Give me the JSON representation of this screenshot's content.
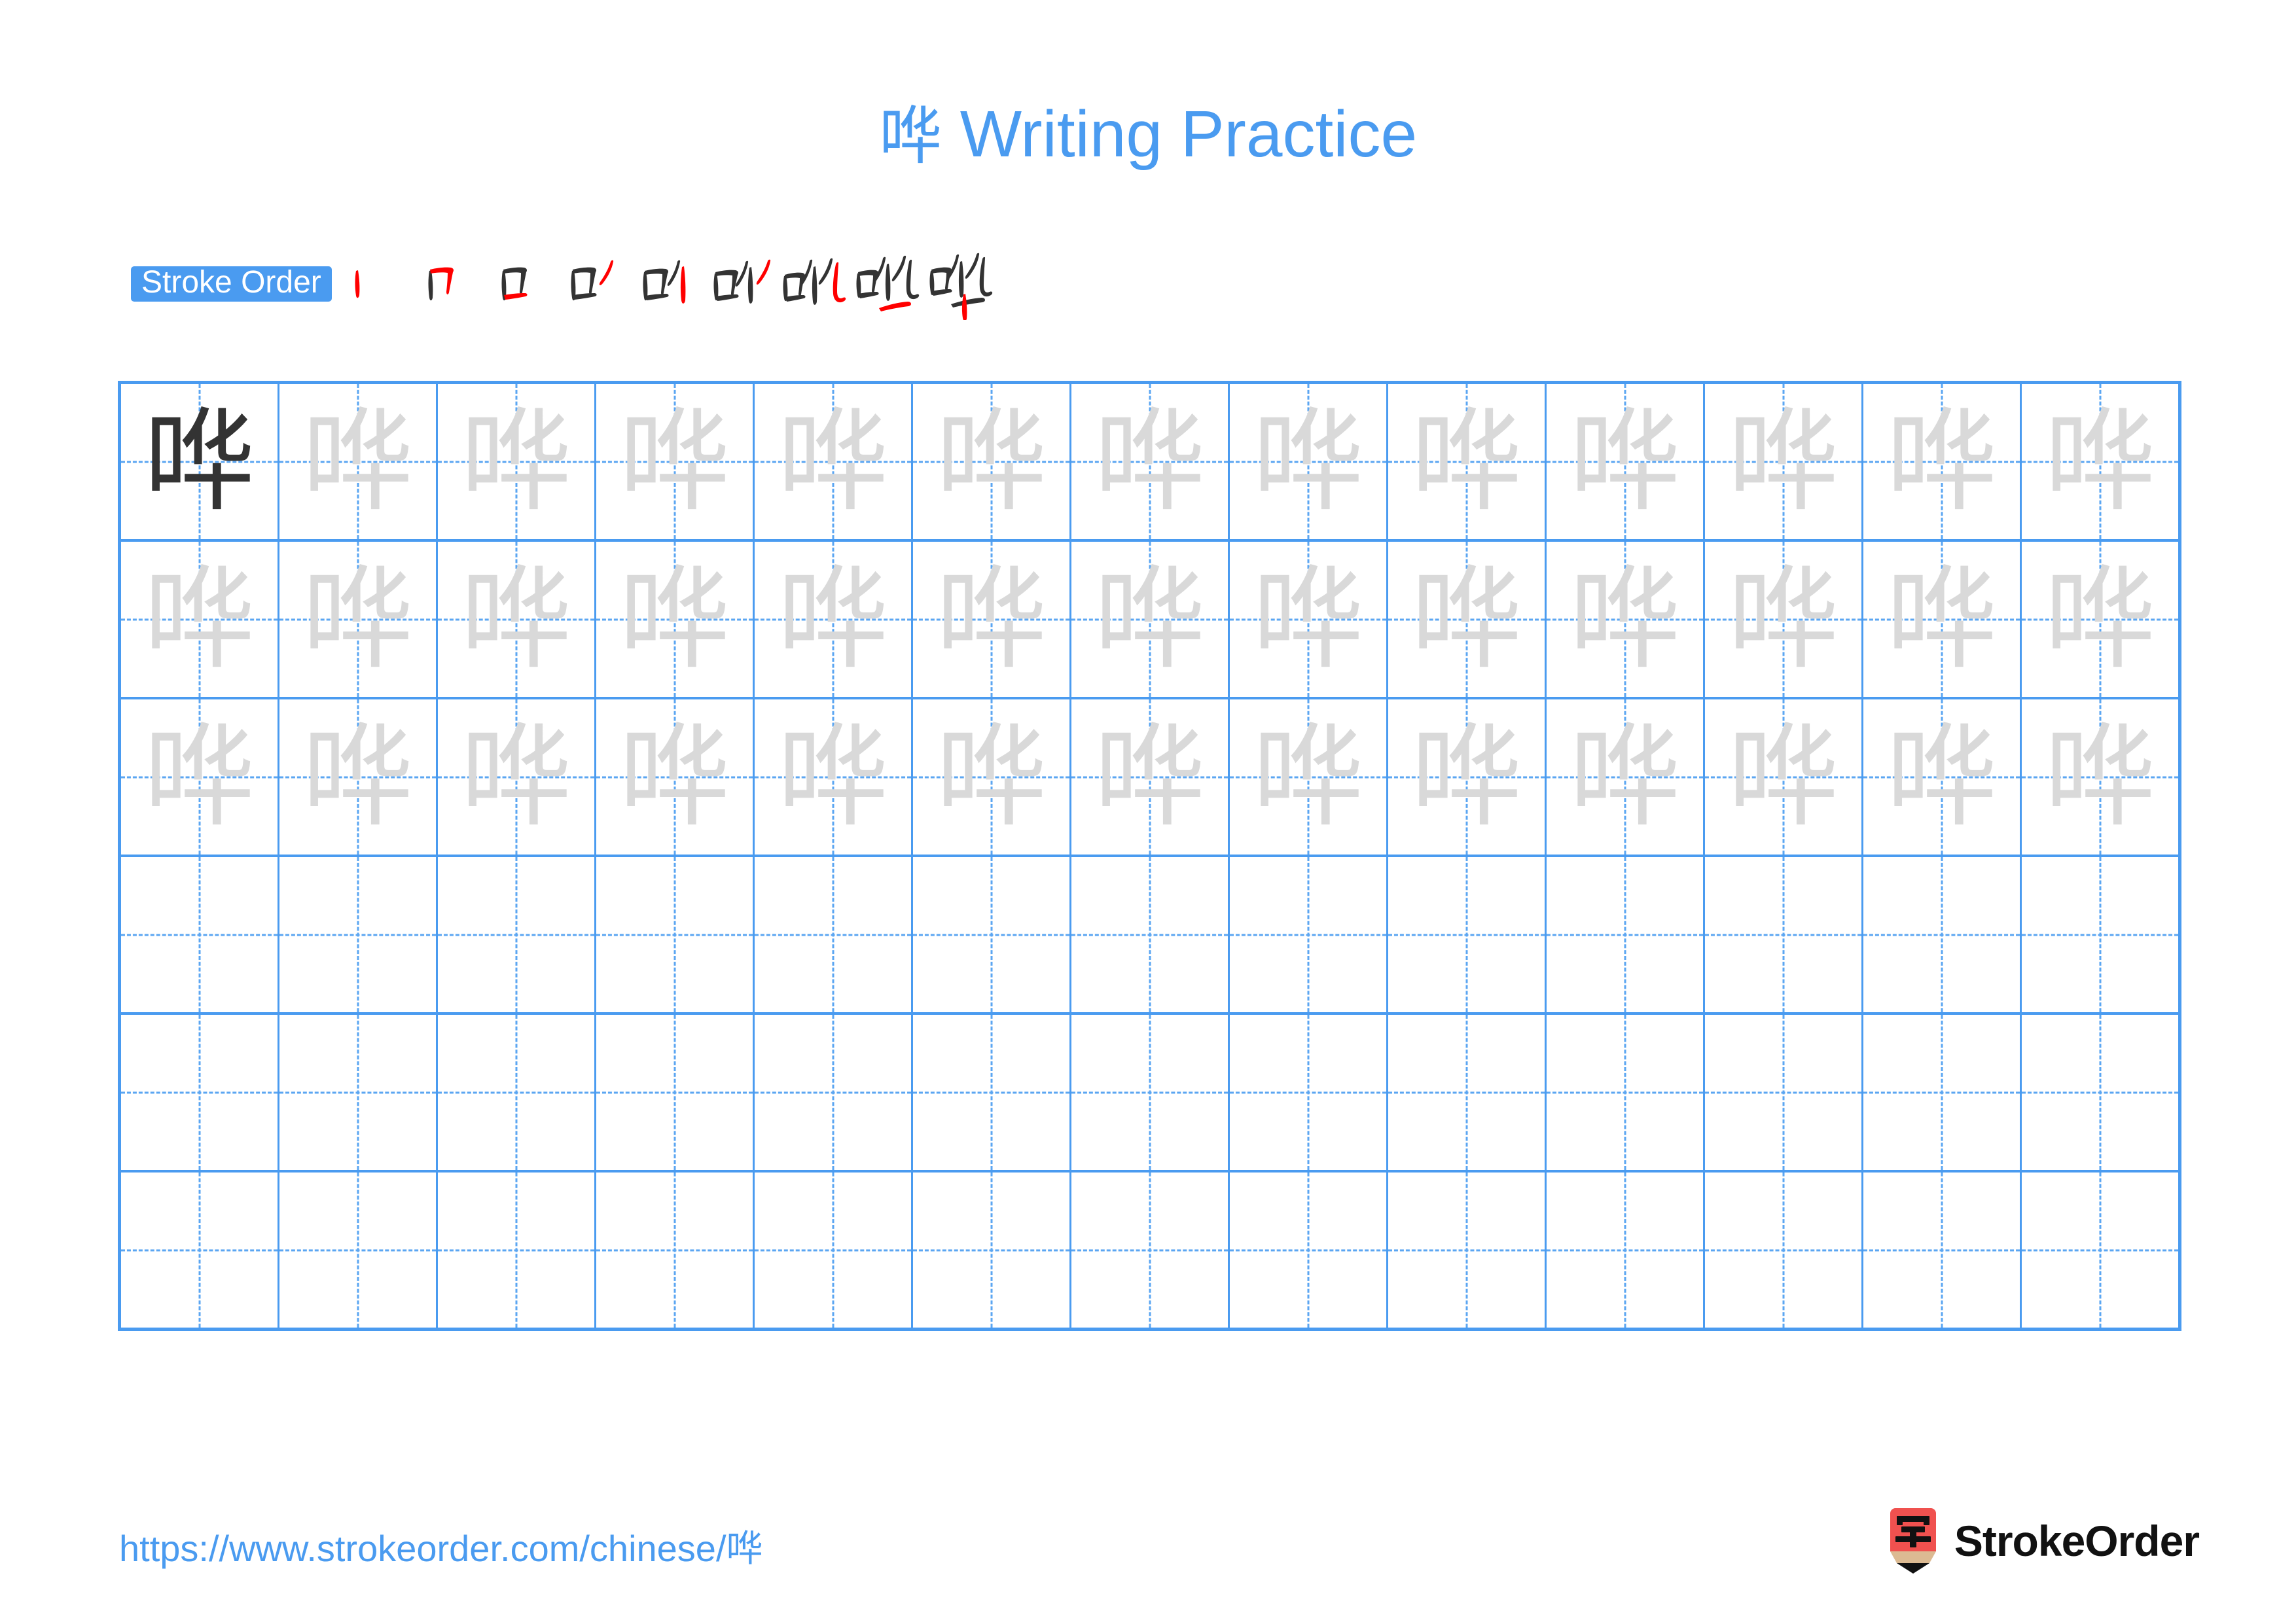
{
  "page": {
    "character": "哗",
    "title_suffix": " Writing Practice",
    "title_full": "哗 Writing Practice",
    "background_color": "#ffffff",
    "accent_color": "#4a9bf0",
    "stroke_highlight_color": "#ff0000",
    "stroke_existing_color": "#333333",
    "ghost_char_color": "#d9d9d9",
    "dark_char_color": "#333333"
  },
  "stroke_order": {
    "badge_label": "Stroke Order",
    "total_strokes": 9,
    "steps": [
      {
        "index": 1,
        "name": "stroke-step-1",
        "cumulative": "丨"
      },
      {
        "index": 2,
        "name": "stroke-step-2",
        "cumulative": "冂"
      },
      {
        "index": 3,
        "name": "stroke-step-3",
        "cumulative": "口"
      },
      {
        "index": 4,
        "name": "stroke-step-4",
        "cumulative": "口丿"
      },
      {
        "index": 5,
        "name": "stroke-step-5",
        "cumulative": "口亻"
      },
      {
        "index": 6,
        "name": "stroke-step-6",
        "cumulative": "口亻丿"
      },
      {
        "index": 7,
        "name": "stroke-step-7",
        "cumulative": "口化"
      },
      {
        "index": 8,
        "name": "stroke-step-8",
        "cumulative": "口化一"
      },
      {
        "index": 9,
        "name": "stroke-step-9",
        "cumulative": "哗"
      }
    ]
  },
  "practice_grid": {
    "columns": 13,
    "rows": 6,
    "rows_data": [
      {
        "row": 1,
        "cells": [
          {
            "char": "哗",
            "style": "dark"
          },
          {
            "char": "哗",
            "style": "ghost"
          },
          {
            "char": "哗",
            "style": "ghost"
          },
          {
            "char": "哗",
            "style": "ghost"
          },
          {
            "char": "哗",
            "style": "ghost"
          },
          {
            "char": "哗",
            "style": "ghost"
          },
          {
            "char": "哗",
            "style": "ghost"
          },
          {
            "char": "哗",
            "style": "ghost"
          },
          {
            "char": "哗",
            "style": "ghost"
          },
          {
            "char": "哗",
            "style": "ghost"
          },
          {
            "char": "哗",
            "style": "ghost"
          },
          {
            "char": "哗",
            "style": "ghost"
          },
          {
            "char": "哗",
            "style": "ghost"
          }
        ]
      },
      {
        "row": 2,
        "cells": [
          {
            "char": "哗",
            "style": "ghost"
          },
          {
            "char": "哗",
            "style": "ghost"
          },
          {
            "char": "哗",
            "style": "ghost"
          },
          {
            "char": "哗",
            "style": "ghost"
          },
          {
            "char": "哗",
            "style": "ghost"
          },
          {
            "char": "哗",
            "style": "ghost"
          },
          {
            "char": "哗",
            "style": "ghost"
          },
          {
            "char": "哗",
            "style": "ghost"
          },
          {
            "char": "哗",
            "style": "ghost"
          },
          {
            "char": "哗",
            "style": "ghost"
          },
          {
            "char": "哗",
            "style": "ghost"
          },
          {
            "char": "哗",
            "style": "ghost"
          },
          {
            "char": "哗",
            "style": "ghost"
          }
        ]
      },
      {
        "row": 3,
        "cells": [
          {
            "char": "哗",
            "style": "ghost"
          },
          {
            "char": "哗",
            "style": "ghost"
          },
          {
            "char": "哗",
            "style": "ghost"
          },
          {
            "char": "哗",
            "style": "ghost"
          },
          {
            "char": "哗",
            "style": "ghost"
          },
          {
            "char": "哗",
            "style": "ghost"
          },
          {
            "char": "哗",
            "style": "ghost"
          },
          {
            "char": "哗",
            "style": "ghost"
          },
          {
            "char": "哗",
            "style": "ghost"
          },
          {
            "char": "哗",
            "style": "ghost"
          },
          {
            "char": "哗",
            "style": "ghost"
          },
          {
            "char": "哗",
            "style": "ghost"
          },
          {
            "char": "哗",
            "style": "ghost"
          }
        ]
      },
      {
        "row": 4,
        "cells": [
          {
            "char": "",
            "style": "blank"
          },
          {
            "char": "",
            "style": "blank"
          },
          {
            "char": "",
            "style": "blank"
          },
          {
            "char": "",
            "style": "blank"
          },
          {
            "char": "",
            "style": "blank"
          },
          {
            "char": "",
            "style": "blank"
          },
          {
            "char": "",
            "style": "blank"
          },
          {
            "char": "",
            "style": "blank"
          },
          {
            "char": "",
            "style": "blank"
          },
          {
            "char": "",
            "style": "blank"
          },
          {
            "char": "",
            "style": "blank"
          },
          {
            "char": "",
            "style": "blank"
          },
          {
            "char": "",
            "style": "blank"
          }
        ]
      },
      {
        "row": 5,
        "cells": [
          {
            "char": "",
            "style": "blank"
          },
          {
            "char": "",
            "style": "blank"
          },
          {
            "char": "",
            "style": "blank"
          },
          {
            "char": "",
            "style": "blank"
          },
          {
            "char": "",
            "style": "blank"
          },
          {
            "char": "",
            "style": "blank"
          },
          {
            "char": "",
            "style": "blank"
          },
          {
            "char": "",
            "style": "blank"
          },
          {
            "char": "",
            "style": "blank"
          },
          {
            "char": "",
            "style": "blank"
          },
          {
            "char": "",
            "style": "blank"
          },
          {
            "char": "",
            "style": "blank"
          },
          {
            "char": "",
            "style": "blank"
          }
        ]
      },
      {
        "row": 6,
        "cells": [
          {
            "char": "",
            "style": "blank"
          },
          {
            "char": "",
            "style": "blank"
          },
          {
            "char": "",
            "style": "blank"
          },
          {
            "char": "",
            "style": "blank"
          },
          {
            "char": "",
            "style": "blank"
          },
          {
            "char": "",
            "style": "blank"
          },
          {
            "char": "",
            "style": "blank"
          },
          {
            "char": "",
            "style": "blank"
          },
          {
            "char": "",
            "style": "blank"
          },
          {
            "char": "",
            "style": "blank"
          },
          {
            "char": "",
            "style": "blank"
          },
          {
            "char": "",
            "style": "blank"
          },
          {
            "char": "",
            "style": "blank"
          }
        ]
      }
    ]
  },
  "footer": {
    "url_prefix": "https://www.strokeorder.com/chinese/",
    "url_character": "哗",
    "url_full": "https://www.strokeorder.com/chinese/哗",
    "logo_glyph": "字",
    "logo_text": "StrokeOrder",
    "logo_badge_color": "#f0514f",
    "logo_pencil_color": "#dcba92"
  }
}
